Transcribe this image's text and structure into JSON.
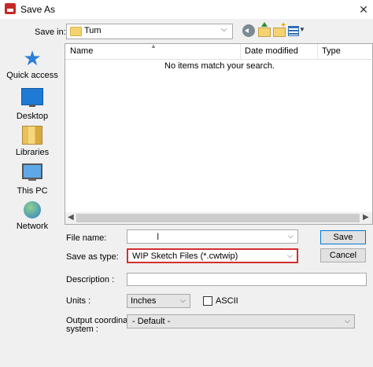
{
  "window": {
    "title": "Save As",
    "close_glyph": "✕"
  },
  "toolbar": {
    "save_in_label": "Save in:",
    "save_in_value": "Tum",
    "icons": [
      "back-icon",
      "up-folder-icon",
      "new-folder-icon",
      "view-menu-icon"
    ]
  },
  "places": [
    {
      "label": "Quick access",
      "icon": "star-icon"
    },
    {
      "label": "Desktop",
      "icon": "desktop-icon"
    },
    {
      "label": "Libraries",
      "icon": "libraries-icon"
    },
    {
      "label": "This PC",
      "icon": "computer-icon"
    },
    {
      "label": "Network",
      "icon": "network-icon"
    }
  ],
  "file_list": {
    "columns": [
      "Name",
      "Date modified",
      "Type"
    ],
    "empty_message": "No items match your search."
  },
  "form": {
    "file_name_label": "File name:",
    "file_name_value": "",
    "save_as_type_label": "Save as type:",
    "save_as_type_value": "WIP Sketch Files (*.cwtwip)",
    "save_button": "Save",
    "cancel_button": "Cancel",
    "description_label": "Description :",
    "description_value": "",
    "units_label": "Units :",
    "units_value": "Inches",
    "ascii_label": "ASCII",
    "ascii_checked": false,
    "ocs_label_line1": "Output coordinate",
    "ocs_label_line2": "system :",
    "ocs_value": "- Default -"
  },
  "colors": {
    "highlight_border": "#d32f2f",
    "accent": "#0078d7"
  }
}
